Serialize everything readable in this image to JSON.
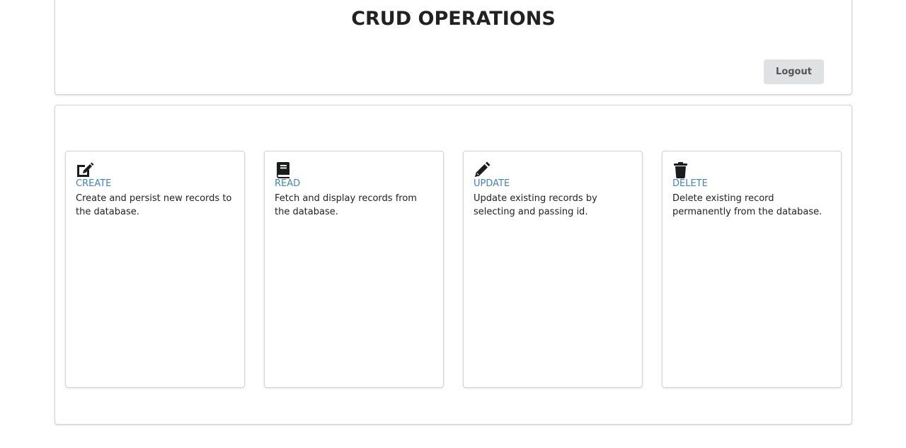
{
  "header": {
    "title": "CRUD OPERATIONS",
    "logout_label": "Logout"
  },
  "cards": [
    {
      "title": "CREATE",
      "description": "Create and persist new records to the database.",
      "icon": "edit-icon"
    },
    {
      "title": "READ",
      "description": "Fetch and display records from the database.",
      "icon": "book-icon"
    },
    {
      "title": "UPDATE",
      "description": "Update existing records by selecting and passing id.",
      "icon": "pencil-icon"
    },
    {
      "title": "DELETE",
      "description": "Delete existing record permanently from the database.",
      "icon": "trash-icon"
    }
  ],
  "colors": {
    "link": "#4183c4",
    "button_bg": "#e0e1e2",
    "border": "#d4d4d5"
  }
}
